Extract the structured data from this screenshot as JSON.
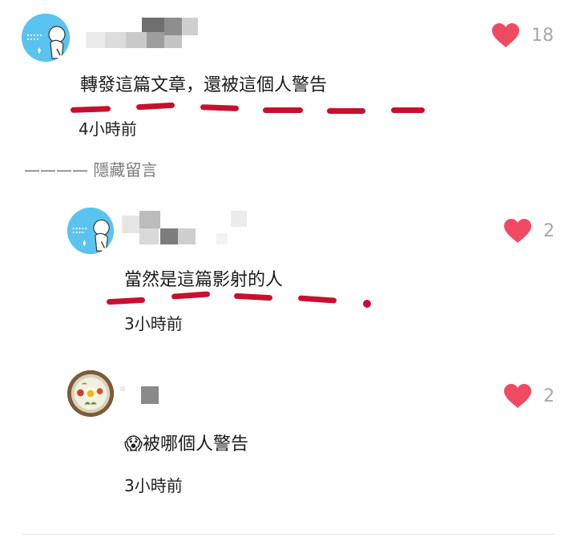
{
  "comments": [
    {
      "text": "轉發這篇文章，還被這個人警告",
      "time": "4小時前",
      "likes": "18"
    }
  ],
  "hidden_toggle": "———— 隱藏留言",
  "replies": [
    {
      "text": "當然是這篇影射的人",
      "time": "3小時前",
      "likes": "2"
    },
    {
      "emoji": "😱",
      "text": "被哪個人警告",
      "time": "3小時前",
      "likes": "2"
    }
  ],
  "colors": {
    "heart": "#f04a63",
    "like_count": "#a8a8a8",
    "marker": "#c8102e",
    "avatar_bg": "#5bc3ef"
  },
  "icons": {
    "like": "heart-icon",
    "emoji": "screaming-face-icon"
  }
}
